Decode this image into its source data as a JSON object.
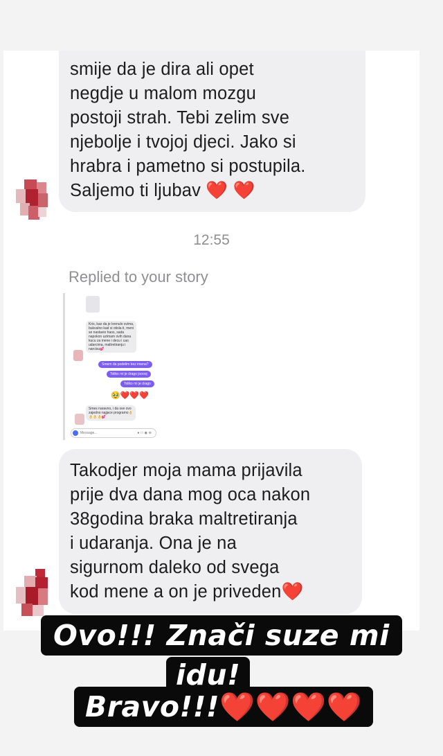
{
  "messages": {
    "first_partial_line": "smije da je dira ali opet\nnegdje u malom mozgu\npostoji strah. Tebi zelim sve\nnjebolje i tvojoj djeci. Jako si\nhrabra i pametno si postupila.\nSaljemo ti ljubav ❤️ ❤️",
    "timestamp": "12:55",
    "replied_label": "Replied to your story",
    "second": "Takodjer moja mama prijavila\nprije dva dana mog oca nakon\n38godina braka maltretiranja\ni udaranja. Ona je na\nsigurnom daleko od svega\nkod mene a on je priveden❤️"
  },
  "story_preview": {
    "incoming_1": "Kris, kao da je krenulo svima,\nbukvalno kad si otisla ti, meni\nse nastavio haos, sada\nnapokon uzimam ovih dana\nkucu za mene i decu i cao\nudarcima, maltretiranju i\nnarcisu💕",
    "outgoing_1": "Smem da podelim bez imena?",
    "outgoing_2": "Toliko mi je drago jooooj",
    "outgoing_3": "Toliko mi je drago",
    "reaction": "🥹❤️❤️❤️",
    "incoming_2": "Smes naravno, i da sve ovo\nzajedno najjace programo👌\n👌👌👌💕",
    "message_placeholder": "Message..."
  },
  "caption": {
    "line1": "Ovo!!! Znači suze mi",
    "line2": "idu!",
    "line3_text": "Bravo!!!",
    "line3_hearts": "❤️❤️❤️❤️"
  },
  "colors": {
    "bubble": "#efeff2",
    "caption_bg": "#0a0a0a",
    "story_outgoing": "#7c5cf4",
    "heart": "#e8262f"
  }
}
